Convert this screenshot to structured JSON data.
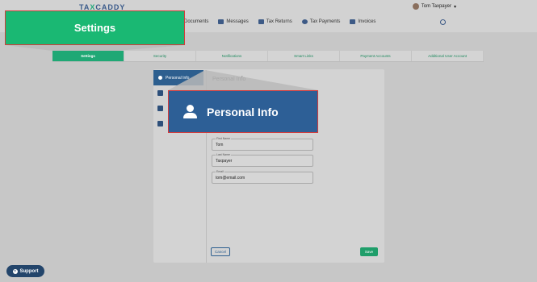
{
  "header": {
    "logo_prefix": "TA",
    "logo_x": "X",
    "logo_suffix": "CADDY",
    "user_name": "Tom Taxpayer",
    "nav": [
      {
        "label": "Documents",
        "icon": "documents-icon"
      },
      {
        "label": "Messages",
        "icon": "messages-icon"
      },
      {
        "label": "Tax Returns",
        "icon": "tax-returns-icon"
      },
      {
        "label": "Tax Payments",
        "icon": "tax-payments-icon"
      },
      {
        "label": "Invoices",
        "icon": "invoices-icon"
      }
    ],
    "search_icon": "search-icon"
  },
  "settings_tabs": [
    {
      "label": "Settings",
      "active": true
    },
    {
      "label": "Security"
    },
    {
      "label": "Notifications"
    },
    {
      "label": "Smart Links"
    },
    {
      "label": "Payment Accounts"
    },
    {
      "label": "Additional User Account"
    }
  ],
  "sidebar": {
    "active_label": "Personal Info"
  },
  "panel": {
    "title": "Personal Info",
    "fields": [
      {
        "label": "First Name",
        "value": "Tom"
      },
      {
        "label": "Last Name",
        "value": "Taxpayer"
      },
      {
        "label": "Email",
        "value": "tom@email.com"
      }
    ],
    "cancel": "Cancel",
    "save": "Save"
  },
  "callouts": {
    "settings": "Settings",
    "personal_info": "Personal Info"
  },
  "support": {
    "label": "Support"
  },
  "colors": {
    "accent_green": "#1fa875",
    "accent_blue": "#2d5f96",
    "highlight_border": "#d33b3b"
  }
}
